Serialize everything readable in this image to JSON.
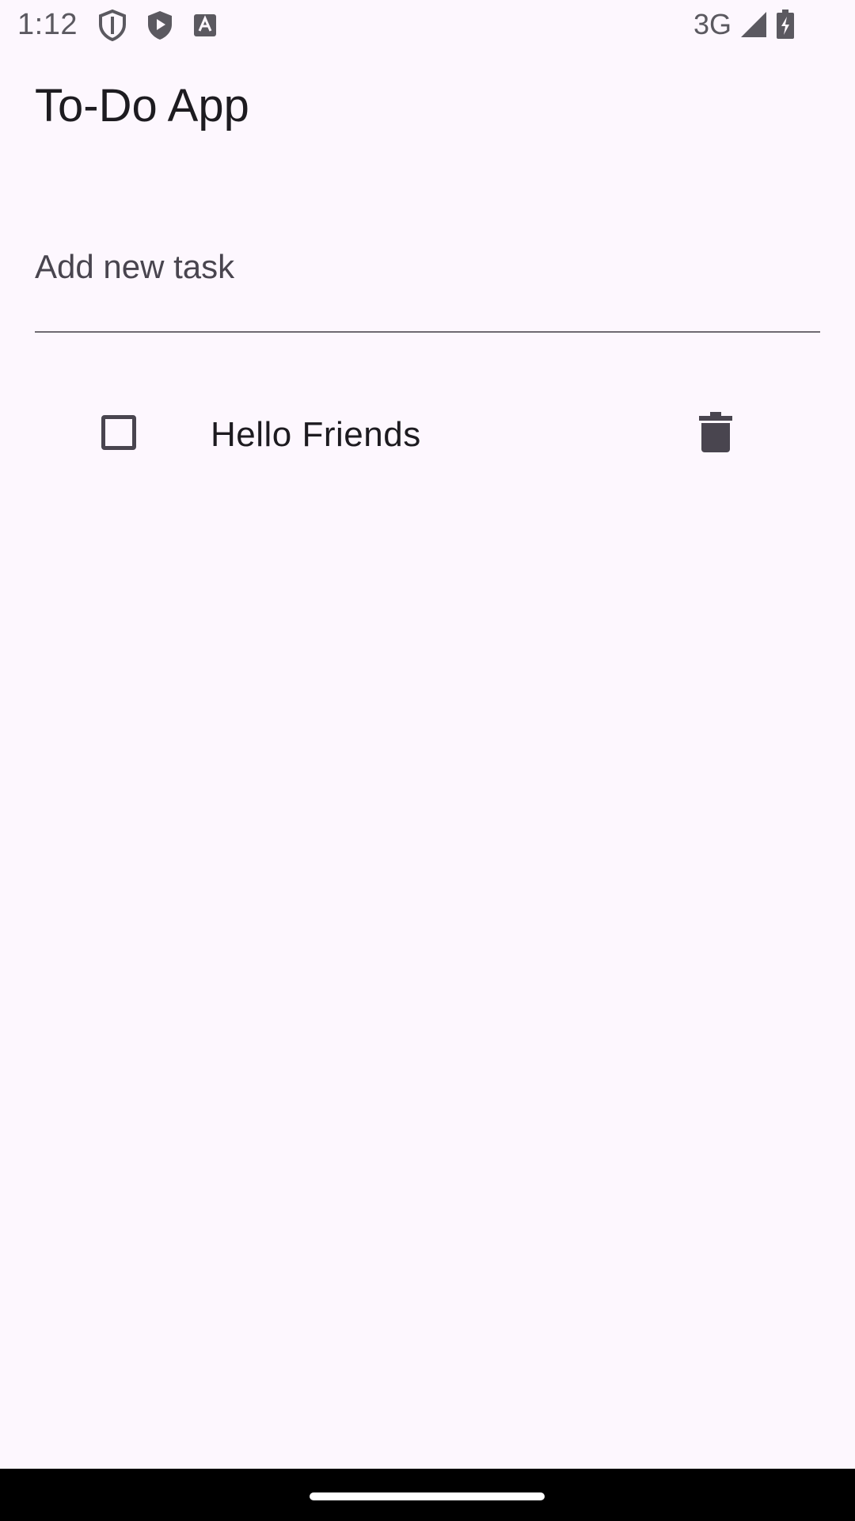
{
  "status_bar": {
    "time": "1:12",
    "network": "3G",
    "left_icons": [
      "shield-outline-icon",
      "shield-play-icon",
      "text-a-icon"
    ],
    "right_icons": [
      "signal-icon",
      "battery-charging-icon"
    ]
  },
  "app": {
    "title": "To-Do App"
  },
  "task_input": {
    "placeholder": "Add new task",
    "value": ""
  },
  "tasks": [
    {
      "label": "Hello Friends",
      "checked": false
    }
  ],
  "colors": {
    "background": "#FDF7FE",
    "text": "#1D1B20",
    "secondary_text": "#49454F",
    "icon": "#49454F",
    "nav_bar": "#000000"
  }
}
